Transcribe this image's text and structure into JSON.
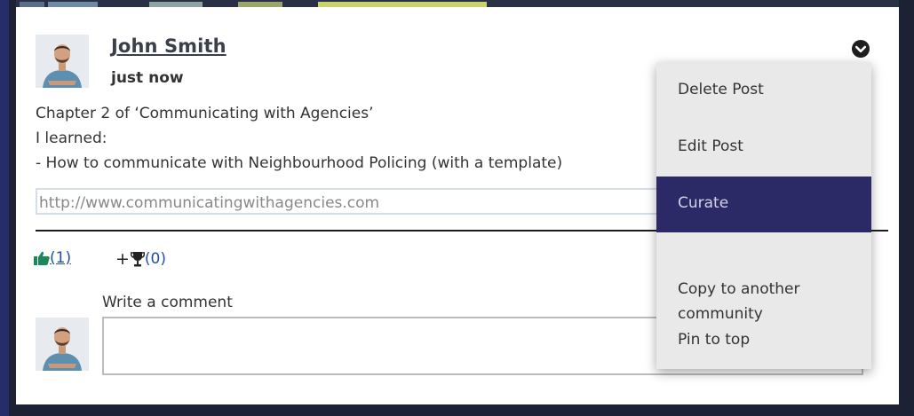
{
  "post": {
    "author": {
      "name": "John Smith",
      "avatar_icon": "person-avatar-icon"
    },
    "time": "just now",
    "body_lines": [
      "Chapter 2 of ‘Communicating with Agencies’",
      "I learned:",
      "- How to communicate with Neighbourhood Policing (with a template)"
    ],
    "link_url": "http://www.communicatingwithagencies.com"
  },
  "actions": {
    "like_count": "(1)",
    "award_plus": "+",
    "award_count": "(0)",
    "like_icon": "thumbs-up-icon",
    "award_icon": "trophy-icon"
  },
  "comment": {
    "label": "Write a comment",
    "value": ""
  },
  "menu": {
    "toggle_icon": "chevron-down-icon",
    "items": [
      {
        "label": "Delete Post"
      },
      {
        "label": "Edit Post"
      },
      {
        "label": "Curate"
      },
      {
        "label": "Copy to another\ncommunity"
      },
      {
        "label": "Pin to top"
      }
    ],
    "active_index": 2
  },
  "colors": {
    "menu_active_bg": "#2c2967",
    "link_blue": "#1f4fa8",
    "like_green": "#1a8a5a",
    "frame_dark": "#1c2233"
  }
}
